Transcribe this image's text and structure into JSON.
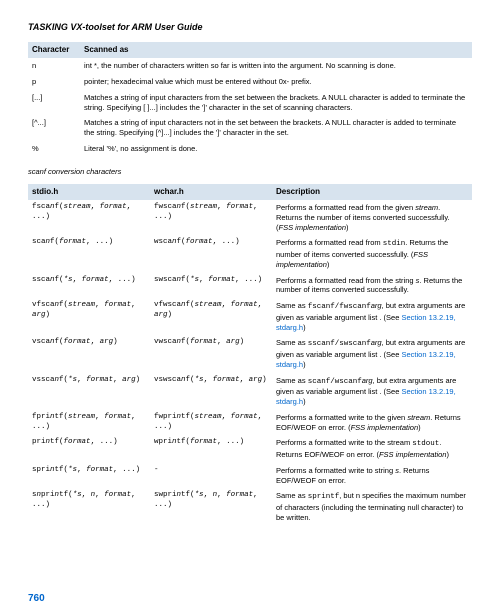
{
  "doc_title": "TASKING VX-toolset for ARM User Guide",
  "table1": {
    "headers": [
      "Character",
      "Scanned as"
    ],
    "rows": [
      {
        "c": "n",
        "d": "int *, the number of characters written so far is written into the argument. No scanning is done."
      },
      {
        "c": "p",
        "d": "pointer; hexadecimal value which must be entered without 0x- prefix."
      },
      {
        "c": "[...]",
        "d": "Matches a string of input characters from the set between the brackets. A NULL character is added to terminate the string. Specifying [ ]...] includes the ']' character in the set of scanning characters."
      },
      {
        "c": "[^...]",
        "d": "Matches a string of input characters not in the set between the brackets. A NULL character is added to terminate the string. Specifying [^]...] includes the ']' character in the set."
      },
      {
        "c": "%",
        "d": "Literal '%', no assignment is done."
      }
    ]
  },
  "caption": "scanf conversion characters",
  "table2": {
    "headers": [
      "stdio.h",
      "wchar.h",
      "Description"
    ],
    "rows": [
      {
        "stdio": "fscanf(stream, format, ...)",
        "wchar": "fwscanf(stream, format, ...)",
        "desc_pre": "Performs a formatted read from the given ",
        "desc_it": "stream",
        "desc_post": ". Returns the number of items converted successfully. (",
        "desc_it2": "FSS implementation",
        "desc_end": ")"
      },
      {
        "stdio": "scanf(format, ...)",
        "wchar": "wscanf(format, ...)",
        "desc_pre": "Performs a formatted read from ",
        "desc_code": "stdin",
        "desc_post": ". Returns the number of items converted successfully. (",
        "desc_it2": "FSS implementation",
        "desc_end": ")"
      },
      {
        "stdio": "sscanf(*s, format, ...)",
        "wchar": "swscanf(*s, format, ...)",
        "desc_pre": "Performs a formatted read from the string ",
        "desc_it": "s",
        "desc_post": ". Returns the number of items converted successfully.",
        "desc_it2": "",
        "desc_end": ""
      },
      {
        "stdio": "vfscanf(stream, format, arg)",
        "wchar": "vfwscanf(stream, format, arg)",
        "desc_pre": "Same as ",
        "desc_code": "fscanf/fwscanf",
        "desc_post": ", but extra arguments are given as variable argument list ",
        "desc_it": "arg",
        "desc_post2": ". (See ",
        "desc_link": "Section 13.2.19, stdarg.h",
        "desc_end": ")"
      },
      {
        "stdio": "vscanf(format, arg)",
        "wchar": "vwscanf(format, arg)",
        "desc_pre": "Same as ",
        "desc_code": "sscanf/swscanf",
        "desc_post": ", but extra arguments are given as variable argument list ",
        "desc_it": "arg",
        "desc_post2": ". (See ",
        "desc_link": "Section 13.2.19, stdarg.h",
        "desc_end": ")"
      },
      {
        "stdio": "vsscanf(*s, format, arg)",
        "wchar": "vswscanf(*s, format, arg)",
        "desc_pre": "Same as ",
        "desc_code": "scanf/wscanf",
        "desc_post": ", but extra arguments are given as variable argument list ",
        "desc_it": "arg",
        "desc_post2": ". (See ",
        "desc_link": "Section 13.2.19, stdarg.h",
        "desc_end": ")"
      },
      {
        "stdio": "fprintf(stream, format, ...)",
        "wchar": "fwprintf(stream, format, ...)",
        "desc_pre": "Performs a formatted write to the given ",
        "desc_it": "stream",
        "desc_post": ". Returns EOF/WEOF on error. (",
        "desc_it2": "FSS implementation",
        "desc_end": ")"
      },
      {
        "stdio": "printf(format, ...)",
        "wchar": "wprintf(format, ...)",
        "desc_pre": "Performs a formatted write to the stream ",
        "desc_code": "stdout",
        "desc_post": ". Returns EOF/WEOF on error. (",
        "desc_it2": "FSS implementation",
        "desc_end": ")"
      },
      {
        "stdio": "sprintf(*s, format, ...)",
        "wchar": "-",
        "desc_pre": "Performs a formatted write to string ",
        "desc_it": "s",
        "desc_post": ". Returns EOF/WEOF on error.",
        "desc_it2": "",
        "desc_end": ""
      },
      {
        "stdio": "snprintf(*s, n, format, ...)",
        "wchar": "swprintf(*s, n, format, ...)",
        "desc_pre": "Same as ",
        "desc_code": "sprintf",
        "desc_post": ", but n specifies the maximum number of characters (including the terminating null character) to be written.",
        "desc_it2": "",
        "desc_end": ""
      }
    ]
  },
  "page_num": "760"
}
